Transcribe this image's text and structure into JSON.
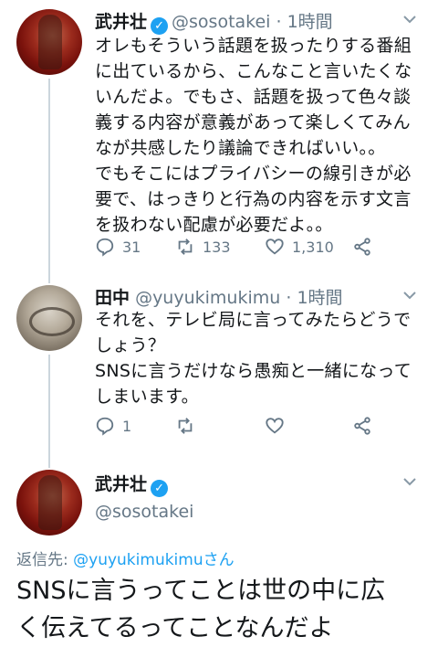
{
  "tweet1": {
    "name": "武井壮",
    "handle": "@sosotakei",
    "separator": "·",
    "time": "1時間",
    "text": "オレもそういう話題を扱ったりする番組\nに出ているから、こんなこと言いたくな\nいんだよ。でもさ、話題を扱って色々談\n義する内容が意義があって楽しくてみん\nなが共感したり議論できればいい。。\nでもそこにはプライバシーの線引きが必\n要で、はっきりと行為の内容を示す文言\nを扱わない配慮が必要だよ。。",
    "replies": "31",
    "retweets": "133",
    "likes": "1,310"
  },
  "tweet2": {
    "name": "田中",
    "handle": "@yuyukimukimu",
    "separator": "·",
    "time": "1時間",
    "text": "それを、テレビ局に言ってみたらどうで\nしょう？\nSNSに言うだけなら愚痴と一緒になって\nしまいます。",
    "replies": "1",
    "retweets": "",
    "likes": ""
  },
  "tweet3": {
    "name": "武井壮",
    "handle": "@sosotakei",
    "replying_label": "返信先: ",
    "replying_to": "@yuyukimukimuさん",
    "text": "SNSに言うってことは世の中に広\nく伝えてるってことなんだよ"
  },
  "colors": {
    "accent": "#1da1f2",
    "muted": "#657786",
    "text": "#14171a"
  }
}
